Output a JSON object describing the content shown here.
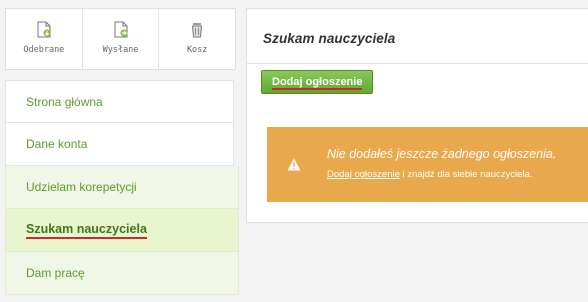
{
  "mailbox": {
    "buttons": [
      {
        "label": "Odebrane",
        "icon": "inbox-document-icon"
      },
      {
        "label": "Wysłane",
        "icon": "sent-document-icon"
      },
      {
        "label": "Kosz",
        "icon": "trash-icon"
      }
    ]
  },
  "sidebar": {
    "items": [
      {
        "label": "Strona główna"
      },
      {
        "label": "Dane konta"
      },
      {
        "label": "Udzielam korepetycji"
      },
      {
        "label": "Szukam nauczyciela"
      },
      {
        "label": "Dam pracę"
      }
    ]
  },
  "main": {
    "title": "Szukam nauczyciela",
    "add_button_label": "Dodaj ogłoszenie",
    "alert": {
      "message": "Nie dodałeś jeszcze żadnego ogłoszenia.",
      "link_text": "Dodaj ogłoszenie",
      "rest_text": " i znajdź dla siebie nauczyciela."
    }
  },
  "colors": {
    "accent_green": "#5d9d28",
    "alert_orange": "#eaa84c",
    "underline_red": "#cc2b2b"
  }
}
